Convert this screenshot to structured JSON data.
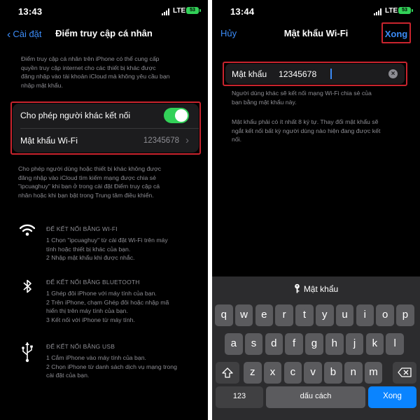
{
  "left": {
    "status": {
      "time": "13:43",
      "network": "LTE",
      "battery": "53"
    },
    "nav": {
      "back": "Cài đặt",
      "title": "Điểm truy cập cá nhân"
    },
    "intro": [
      "Điểm truy cập cá nhân trên iPhone có thể cung cấp",
      "quyền truy cập internet cho các thiết bị khác được",
      "đăng nhập vào tài khoản iCloud mà không yêu cầu bạn",
      "nhập mật khẩu."
    ],
    "allow": {
      "label": "Cho phép người khác kết nối",
      "enabled": true
    },
    "wifi_password": {
      "label": "Mật khẩu Wi-Fi",
      "value": "12345678"
    },
    "allow_note": [
      "Cho phép người dùng hoặc thiết bị khác không được",
      "đăng nhập vào iCloud tìm kiếm mạng được chia sẻ",
      "\"ipcuaghuy\" khi bạn ở trong cài đặt Điểm truy cập cá",
      "nhân hoặc khi bạn bật trong Trung tâm điều khiển."
    ],
    "sections": [
      {
        "icon": "wifi-icon",
        "title": "ĐỂ KẾT NỐI BẰNG WI-FI",
        "steps": [
          "1 Chọn \"ipcuaghuy\" từ cài đặt Wi-Fi trên máy",
          "   tính hoặc thiết bị khác của bạn.",
          "2 Nhập mật khẩu khi được nhắc."
        ]
      },
      {
        "icon": "bluetooth-icon",
        "title": "ĐỂ KẾT NỐI BẰNG BLUETOOTH",
        "steps": [
          "1 Ghép đôi iPhone với máy tính của bạn.",
          "2 Trên iPhone, chạm Ghép đôi hoặc nhập mã",
          "   hiển thị trên máy tính của bạn.",
          "3 Kết nối với iPhone từ máy tính."
        ]
      },
      {
        "icon": "usb-icon",
        "title": "ĐỂ KẾT NỐI BẰNG USB",
        "steps": [
          "1 Cắm iPhone vào máy tính của bạn.",
          "2 Chọn iPhone từ danh sách dịch vụ mạng trong",
          "   cài đặt của bạn."
        ]
      }
    ]
  },
  "right": {
    "status": {
      "time": "13:44",
      "network": "LTE",
      "battery": "53"
    },
    "nav": {
      "cancel": "Hủy",
      "title": "Mật khẩu Wi-Fi",
      "done": "Xong"
    },
    "field": {
      "label": "Mật khẩu",
      "value": "12345678"
    },
    "note1": [
      "Người dùng khác sẽ kết nối mạng Wi-Fi chia sẻ của",
      "bạn bằng mật khẩu này."
    ],
    "note2": [
      "Mật khẩu phải có ít nhất 8 ký tự. Thay đổi mật khẩu sẽ",
      "ngắt kết nối bất kỳ người dùng nào hiện đang được kết",
      "nối."
    ],
    "keyboard": {
      "suggestion": "Mật khẩu",
      "row1": [
        "q",
        "w",
        "e",
        "r",
        "t",
        "y",
        "u",
        "i",
        "o",
        "p"
      ],
      "row2": [
        "a",
        "s",
        "d",
        "f",
        "g",
        "h",
        "j",
        "k",
        "l"
      ],
      "row3": [
        "z",
        "x",
        "c",
        "v",
        "b",
        "n",
        "m"
      ],
      "numbers": "123",
      "space": "dấu cách",
      "return": "Xong",
      "shift_icon": "shift-icon",
      "delete_icon": "delete-icon"
    }
  },
  "colors": {
    "accent": "#3b8bf6",
    "toggle_on": "#32d158",
    "highlight": "#c9242e",
    "return_key": "#0a84ff"
  }
}
